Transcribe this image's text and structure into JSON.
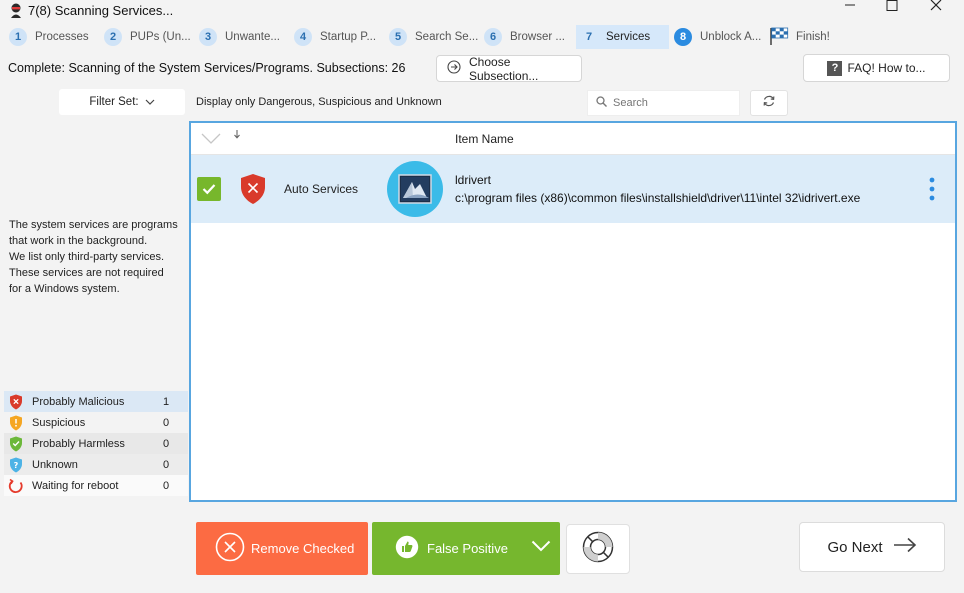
{
  "window": {
    "title": "7(8) Scanning Services..."
  },
  "steps": [
    {
      "num": "1",
      "label": "Processes"
    },
    {
      "num": "2",
      "label": "PUPs (Un..."
    },
    {
      "num": "3",
      "label": "Unwante..."
    },
    {
      "num": "4",
      "label": "Startup P..."
    },
    {
      "num": "5",
      "label": "Search Se..."
    },
    {
      "num": "6",
      "label": "Browser ..."
    },
    {
      "num": "7",
      "label": "Services"
    },
    {
      "num": "8",
      "label": "Unblock A..."
    },
    {
      "num": "",
      "label": "Finish!"
    }
  ],
  "status": {
    "text": "Complete: Scanning of the System Services/Programs. Subsections: 26",
    "choose_label": "Choose Subsection...",
    "faq_label": "FAQ! How to..."
  },
  "filter": {
    "label": "Filter Set:",
    "description": "Display only Dangerous, Suspicious and Unknown",
    "search_placeholder": "Search"
  },
  "left_description": [
    "The system services are programs",
    "that work in the background.",
    "We list only third-party services.",
    "These services are not required",
    "for a Windows system."
  ],
  "stats": [
    {
      "label": "Probably Malicious",
      "count": "1",
      "icon": "shield-red-icon"
    },
    {
      "label": "Suspicious",
      "count": "0",
      "icon": "shield-orange-icon"
    },
    {
      "label": "Probably Harmless",
      "count": "0",
      "icon": "shield-green-icon"
    },
    {
      "label": "Unknown",
      "count": "0",
      "icon": "shield-blue-icon"
    },
    {
      "label": "Waiting for reboot",
      "count": "0",
      "icon": "reboot-icon"
    }
  ],
  "table": {
    "column_item_name": "Item Name",
    "rows": [
      {
        "category": "Auto Services",
        "name": "ldrivert",
        "path": "c:\\program files (x86)\\common files\\installshield\\driver\\11\\intel 32\\idrivert.exe"
      }
    ]
  },
  "actions": {
    "remove_label": "Remove Checked",
    "false_positive_label": "False Positive",
    "go_next_label": "Go Next"
  },
  "colors": {
    "accent": "#2b8be0",
    "remove": "#fc6b43",
    "false_positive": "#76b72e",
    "table_border": "#58a6e0",
    "row_selected": "#dcecf9"
  }
}
